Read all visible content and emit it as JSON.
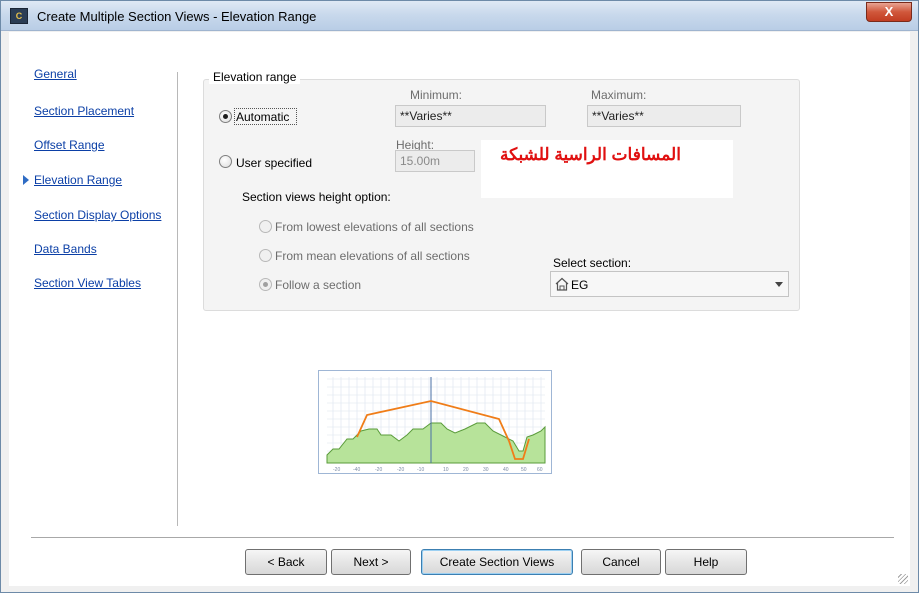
{
  "window": {
    "title": "Create Multiple Section Views - Elevation Range",
    "close_label": "X"
  },
  "nav": {
    "items": [
      {
        "label": "General"
      },
      {
        "label": "Section Placement"
      },
      {
        "label": "Offset Range"
      },
      {
        "label": "Elevation Range",
        "current": true
      },
      {
        "label": "Section Display Options"
      },
      {
        "label": "Data Bands"
      },
      {
        "label": "Section View Tables"
      }
    ]
  },
  "elevation": {
    "group_title": "Elevation range",
    "minimum_label": "Minimum:",
    "minimum_value": "**Varies**",
    "maximum_label": "Maximum:",
    "maximum_value": "**Varies**",
    "automatic_label": "Automatic",
    "user_specified_label": "User specified",
    "height_label": "Height:",
    "height_value": "15.00m",
    "mode": "automatic"
  },
  "height_option": {
    "label": "Section views height option:",
    "options": [
      {
        "label": "From lowest elevations of all sections",
        "selected": false
      },
      {
        "label": "From mean elevations of all sections",
        "selected": false
      },
      {
        "label": "Follow a section",
        "selected": true
      }
    ],
    "select_section_label": "Select section:",
    "select_section_value": "EG"
  },
  "overlay": {
    "text": "المسافات الراسية للشبكة"
  },
  "buttons": {
    "back": "< Back",
    "next": "Next >",
    "create": "Create Section Views",
    "cancel": "Cancel",
    "help": "Help"
  },
  "colors": {
    "link": "#0b3fa6",
    "overlay_text": "#e01010",
    "ground_fill": "#b7e39a",
    "profile_line": "#f07d18"
  }
}
